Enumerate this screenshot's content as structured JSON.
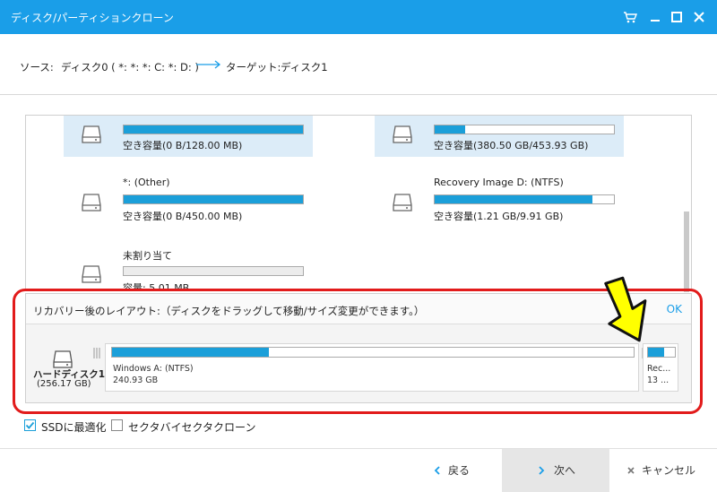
{
  "window": {
    "title": "ディスク/パーティションクローン",
    "controls": [
      "cart-icon",
      "minimize-icon",
      "maximize-icon",
      "close-icon"
    ]
  },
  "source_target": {
    "source_label": "ソース:",
    "source_value": "ディスク0 ( *: *: *: C: *: D: )",
    "target_label": "ターゲット:",
    "target_value": "ディスク1"
  },
  "partitions": [
    {
      "name": "",
      "free": "空き容量(0 B/128.00 MB)",
      "fill_fraction": 1.0,
      "selected": true
    },
    {
      "name": "",
      "free": "空き容量(380.50 GB/453.93 GB)",
      "fill_fraction": 0.17,
      "selected": true
    },
    {
      "name": "*: (Other)",
      "free": "空き容量(0 B/450.00 MB)",
      "fill_fraction": 1.0,
      "selected": false
    },
    {
      "name": "Recovery Image D: (NTFS)",
      "free": "空き容量(1.21 GB/9.91 GB)",
      "fill_fraction": 0.88,
      "selected": false
    },
    {
      "name": "未割り当て",
      "free": "容量: 5.01 MB",
      "fill_fraction": 0.0,
      "selected": false
    }
  ],
  "layout_panel": {
    "header": "リカバリー後のレイアウト:（ディスクをドラッグして移動/サイズ変更ができます。）",
    "ok_label": "OK",
    "disk_name": "ハードディスク1",
    "disk_size": "(256.17 GB)",
    "blocks": [
      {
        "name": "Windows A: (NTFS)",
        "size": "240.93 GB",
        "fill_fraction": 0.3
      },
      {
        "name": "Rec...",
        "size": "13 ...",
        "fill_fraction": 0.6
      }
    ]
  },
  "options": {
    "ssd_label": "SSDに最適化",
    "ssd_checked": true,
    "sector_label": "セクタバイセクタクローン",
    "sector_checked": false
  },
  "footer": {
    "back_label": "戻る",
    "next_label": "次へ",
    "cancel_label": "キャンセル"
  },
  "colors": {
    "accent": "#1a9ee8",
    "bar_fill": "#1b9fd9",
    "selected_bg": "#dcecf8",
    "highlight_red": "#e21b1b",
    "arrow_yellow": "#ffff00"
  }
}
